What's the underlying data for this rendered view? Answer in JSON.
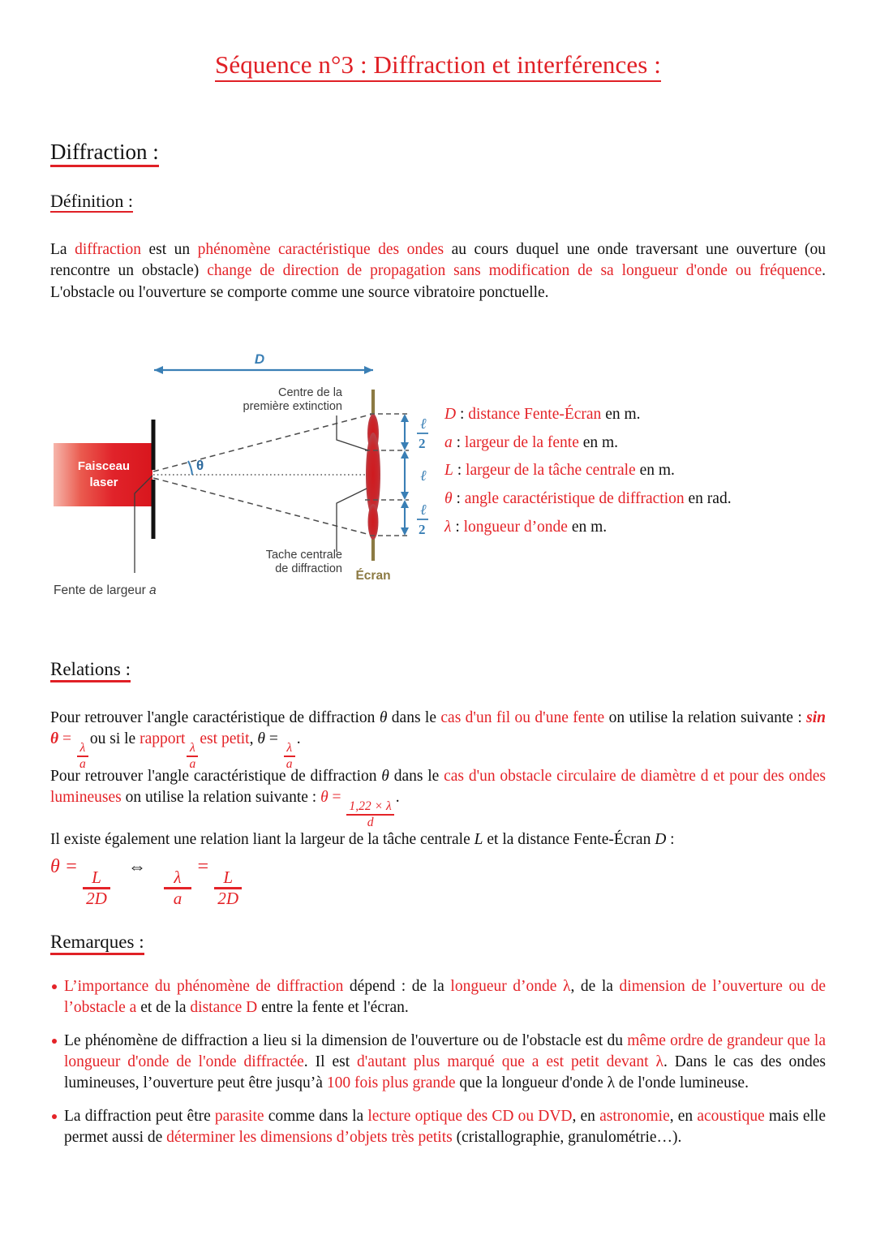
{
  "document": {
    "title": "Séquence n°3 : Diffraction et interférences :"
  },
  "sections": {
    "diffraction_heading": "Diffraction :",
    "definition_heading": "Définition :",
    "relations_heading": "Relations :",
    "remarques_heading": "Remarques :"
  },
  "definition": {
    "p1_t1": "La ",
    "p1_r1": "diffraction",
    "p1_t2": " est un ",
    "p1_r2": "phénomène caractéristique des ondes",
    "p1_t3": " au cours duquel une onde traversant une ouverture (ou rencontre un obstacle) ",
    "p1_r3": "change de direction de propagation sans modification de sa longueur d'onde ou fréquence",
    "p1_t4": ". L'obstacle ou l'ouverture se comporte comme une source vibratoire ponctuelle."
  },
  "figure": {
    "label_laser_line1": "Faisceau",
    "label_laser_line2": "laser",
    "label_distance": "D",
    "label_angle": "θ",
    "label_extinction_line1": "Centre de la",
    "label_extinction_line2": "première extinction",
    "label_tache_line1": "Tache centrale",
    "label_tache_line2": "de diffraction",
    "label_fente": "Fente de largeur a",
    "label_ecran": "Écran",
    "label_half_top_num": "ℓ",
    "label_half_top_den": "2",
    "label_full": "ℓ",
    "label_half_bottom_num": "ℓ",
    "label_half_bottom_den": "2",
    "colors": {
      "laser_red": "#e1232a",
      "blue": "#3a7fb5",
      "screen_brown": "#8c7a43",
      "label_gray": "#3b3b3b"
    }
  },
  "legend": {
    "items": [
      {
        "symbol": "D",
        "sep": " : ",
        "red": "distance Fente-Écran",
        "black": " en m."
      },
      {
        "symbol": "a",
        "sep": " : ",
        "red": "largeur de la fente",
        "black": " en m."
      },
      {
        "symbol": "L",
        "sep": " : ",
        "red": "largeur de la tâche centrale",
        "black": " en m."
      },
      {
        "symbol": "θ",
        "sep": " : ",
        "red": "angle caractéristique de diffraction",
        "black": " en rad."
      },
      {
        "symbol": "λ",
        "sep": " : ",
        "red": "longueur d’onde",
        "black": " en m."
      }
    ]
  },
  "relations": {
    "p1_t1": "Pour retrouver l'angle caractéristique de diffraction ",
    "p1_sym": "θ",
    "p1_t2": " dans le ",
    "p1_r1": "cas d'un fil ou d'une fente",
    "p1_t3": " on utilise la relation suivante : ",
    "p1_f_sin": "sin θ",
    "p1_eq": " = ",
    "p1_frac1_num": "λ",
    "p1_frac1_den": "a",
    "p1_t4": "ou si le ",
    "p1_r2": "rapport",
    "p1_frac2_num": "λ",
    "p1_frac2_den": "a",
    "p1_r3": "est petit",
    "p1_t5": ", ",
    "p1_theta2": "θ",
    "p1_eq2": " = ",
    "p1_frac3_num": "λ",
    "p1_frac3_den": "a",
    "p1_t6": ".",
    "p2_t1": "Pour retrouver l'angle caractéristique de diffraction ",
    "p2_sym": "θ",
    "p2_t2": " dans le ",
    "p2_r1": "cas d'un obstacle circulaire de diamètre d et pour des ondes lumineuses",
    "p2_t3": " on utilise la relation suivante : ",
    "p2_theta": "θ",
    "p2_eq": " = ",
    "p2_frac_num": "1,22 × λ",
    "p2_frac_den": "d",
    "p2_t4": ".",
    "p3_t1": "Il existe également une relation liant la largeur de la tâche centrale ",
    "p3_sym1": "L",
    "p3_t2": " et la distance Fente-Écran ",
    "p3_sym2": "D",
    "p3_t3": " :",
    "formula_theta": "θ",
    "formula_eq1": "=",
    "formula_f1_num": "L",
    "formula_f1_den": "2D",
    "formula_iff": "⇔",
    "formula_f2_num": "λ",
    "formula_f2_den": "a",
    "formula_eq2": "=",
    "formula_f3_num": "L",
    "formula_f3_den": "2D"
  },
  "remarques": {
    "b1_r1": "L’importance du phénomène de diffraction",
    "b1_t1": " dépend : de la ",
    "b1_r2": "longueur d’onde λ",
    "b1_t2": ", de la ",
    "b1_r3": "dimension de l’ouverture ou de l’obstacle a",
    "b1_t3": " et de la ",
    "b1_r4": "distance D",
    "b1_t4": " entre la fente et l'écran.",
    "b2_t1": "Le phénomène de diffraction a lieu si la dimension de l'ouverture ou de l'obstacle est du ",
    "b2_r1": "même ordre de grandeur que la longueur d'onde de l'onde diffractée",
    "b2_t2": ". Il est ",
    "b2_r2": "d'autant plus marqué que a est petit devant λ",
    "b2_t3": ". Dans le cas des ondes lumineuses, l’ouverture peut être jusqu’à ",
    "b2_r3": "100 fois plus grande",
    "b2_t4": " que la longueur d'onde λ de l'onde lumineuse.",
    "b3_t1": "La diffraction peut être ",
    "b3_r1": "parasite",
    "b3_t2": " comme dans la ",
    "b3_r2": "lecture optique des CD ou DVD",
    "b3_t3": ", en ",
    "b3_r3": "astronomie",
    "b3_t4": ", en ",
    "b3_r4": "acoustique",
    "b3_t5": " mais elle permet aussi de ",
    "b3_r5": "déterminer les dimensions d’objets très petits",
    "b3_t6": " (cristallographie, granulométrie…)."
  }
}
